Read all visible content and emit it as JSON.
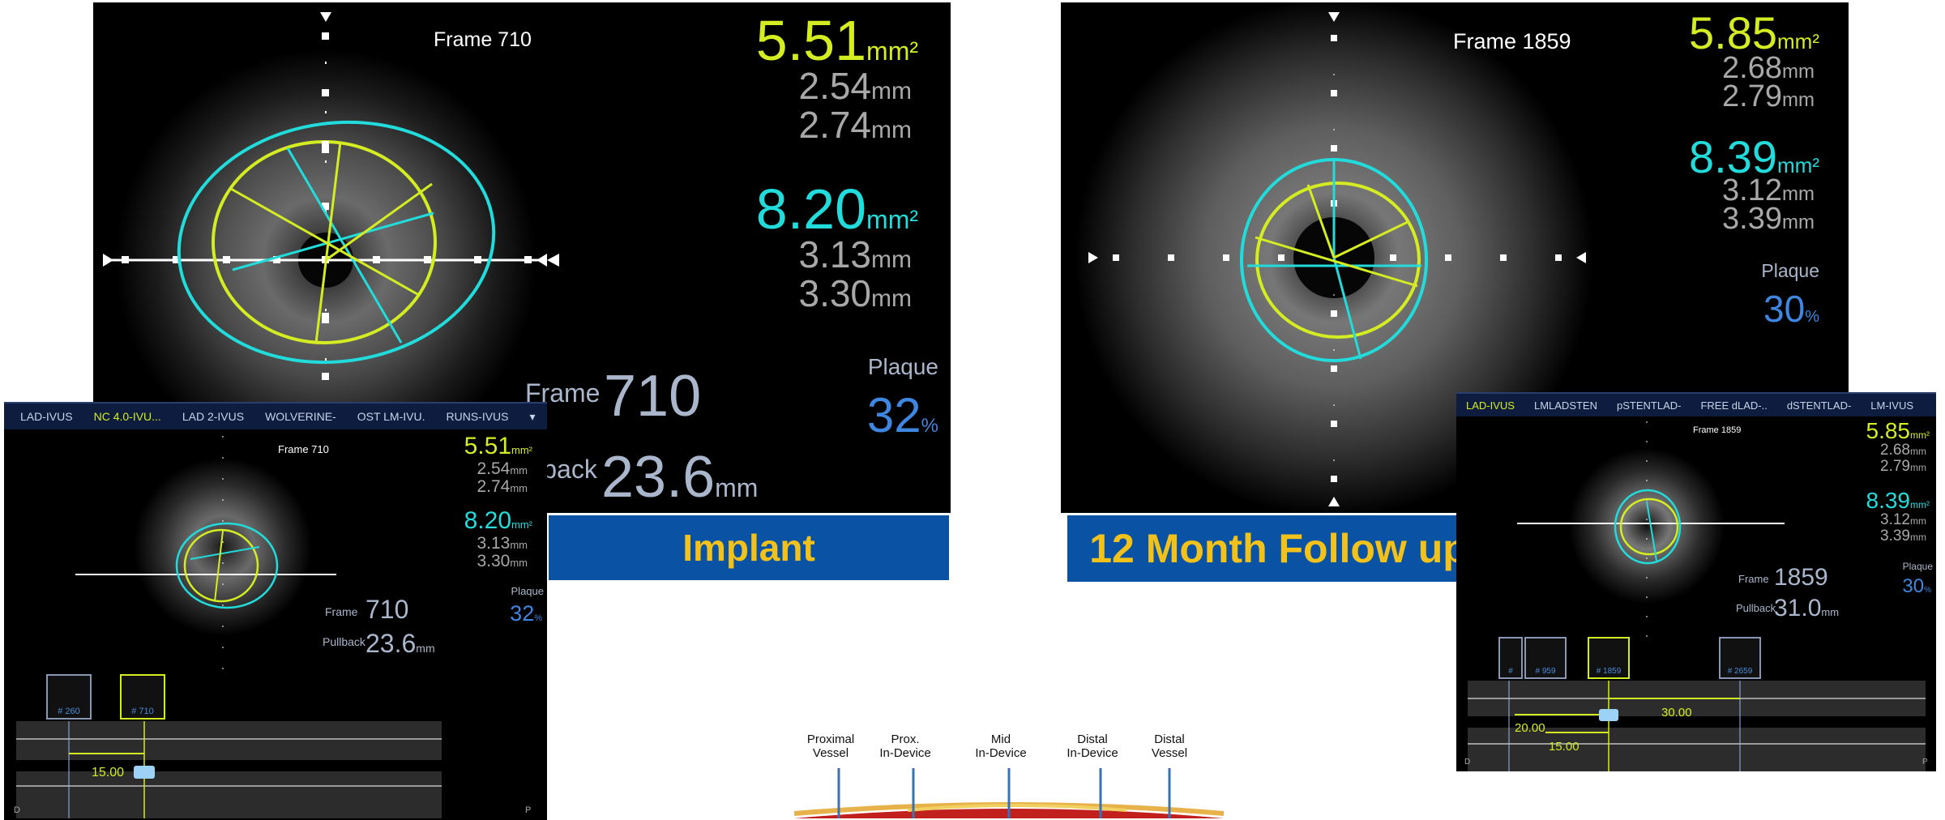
{
  "implant": {
    "frame_label": "Frame 710",
    "lumen_area": "5.51",
    "lumen_area_unit": "mm²",
    "lumen_min": "2.54",
    "lumen_max": "2.74",
    "vessel_area": "8.20",
    "vessel_area_unit": "mm²",
    "vessel_min": "3.13",
    "vessel_max": "3.30",
    "unit_mm": "mm",
    "plaque_label": "Plaque",
    "plaque_value": "32",
    "plaque_unit": "%",
    "frame_word": "Frame",
    "frame_number": "710",
    "pullback_word": "llback",
    "pullback_word_full": "Pullback",
    "pullback_value": "23.6",
    "banner": "Implant"
  },
  "followup": {
    "frame_label": "Frame 1859",
    "lumen_area": "5.85",
    "lumen_area_unit": "mm²",
    "lumen_min": "2.68",
    "lumen_max": "2.79",
    "vessel_area": "8.39",
    "vessel_area_unit": "mm²",
    "vessel_min": "3.12",
    "vessel_max": "3.39",
    "unit_mm": "mm",
    "plaque_label": "Plaque",
    "plaque_value": "30",
    "plaque_unit": "%",
    "frame_word": "Frame",
    "frame_number": "1859",
    "pullback_word": "Pullback",
    "pullback_value": "31.0",
    "banner": "12 Month Follow up"
  },
  "left_ui": {
    "tabs": [
      "LAD-IVUS",
      "NC 4.0-IVU...",
      "LAD 2-IVUS",
      "WOLVERINE-",
      "OST LM-IVU.",
      "RUNS-IVUS",
      "▾"
    ],
    "active_tab": 1,
    "thumbs": [
      "# 260",
      "# 710"
    ],
    "measure": "15.00",
    "corner_d": "D",
    "corner_p": "P"
  },
  "right_ui": {
    "tabs": [
      "LAD-IVUS",
      "LMLADSTEN",
      "pSTENTLAD-",
      "FREE dLAD-..",
      "dSTENTLAD-",
      "LM-IVUS"
    ],
    "active_tab": 0,
    "thumbs": [
      "#",
      "# 959",
      "# 1859",
      "# 2659"
    ],
    "measure_a": "30.00",
    "measure_b": "20.00",
    "measure_c": "15.00",
    "corner_d": "D",
    "corner_p": "P"
  },
  "diagram": {
    "labels": [
      [
        "Proximal",
        "Vessel"
      ],
      [
        "Prox.",
        "In-Device"
      ],
      [
        "Mid",
        "In-Device"
      ],
      [
        "Distal",
        "In-Device"
      ],
      [
        "Distal",
        "Vessel"
      ]
    ]
  },
  "colors": {
    "lumen": "#d4ec22",
    "vessel": "#22dcdc",
    "banner_bg": "#0a53a4",
    "banner_text": "#f2c21b"
  }
}
